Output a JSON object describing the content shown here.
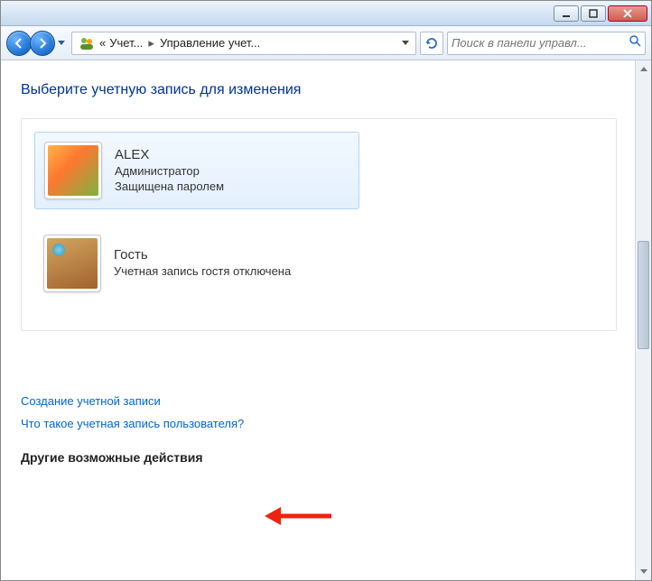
{
  "titlebar": {},
  "breadcrumb": {
    "prefix": "«",
    "seg1": "Учет...",
    "seg2": "Управление учет..."
  },
  "search": {
    "placeholder": "Поиск в панели управл..."
  },
  "heading": "Выберите учетную запись для изменения",
  "accounts": [
    {
      "name": "ALEX",
      "role": "Администратор",
      "status": "Защищена паролем",
      "selected": true,
      "avatar": "flower"
    },
    {
      "name": "Гость",
      "role": "Учетная запись гостя отключена",
      "status": "",
      "selected": false,
      "avatar": "suitcase"
    }
  ],
  "links": {
    "create": "Создание учетной записи",
    "whatis": "Что такое учетная запись пользователя?"
  },
  "footer_heading": "Другие возможные действия"
}
